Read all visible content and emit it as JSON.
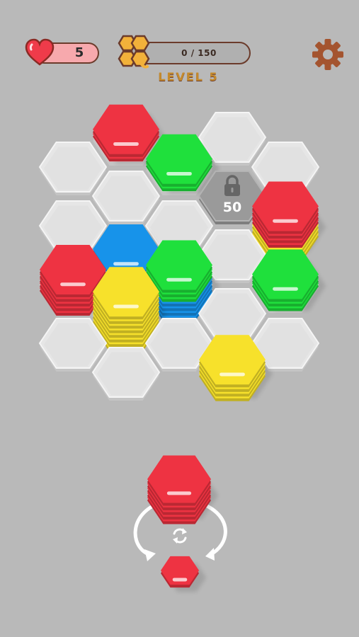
{
  "hud": {
    "lives": "5",
    "progress_text": "0 / 150",
    "progress_value": 0,
    "progress_max": 150,
    "level_label": "LEVEL 5",
    "heart_icon": "heart-icon",
    "honeycomb_icon": "honeycomb-icon",
    "settings_icon": "gear-icon"
  },
  "colors": {
    "red": "#ee3342",
    "green": "#1fe03c",
    "blue": "#1793ea",
    "yellow": "#f7e12b",
    "empty": "#e6e6e6",
    "locked": "#9a9a9a",
    "background": "#b9b9b9",
    "accent_brown": "#6b3b2b"
  },
  "board": {
    "cells": [
      {
        "col": 0,
        "row": 0,
        "state": "empty"
      },
      {
        "col": 0,
        "row": 1,
        "state": "empty"
      },
      {
        "col": 0,
        "row": 2,
        "state": "stack",
        "colors": [
          "red",
          "red",
          "red",
          "red",
          "red"
        ]
      },
      {
        "col": 0,
        "row": 3,
        "state": "empty"
      },
      {
        "col": 1,
        "row": 0,
        "state": "stack",
        "colors": [
          "red",
          "red"
        ]
      },
      {
        "col": 1,
        "row": 1,
        "state": "empty"
      },
      {
        "col": 1,
        "row": 2,
        "state": "stack",
        "colors": [
          "blue"
        ]
      },
      {
        "col": 1,
        "row": 3,
        "state": "stack",
        "colors": [
          "yellow",
          "yellow",
          "yellow",
          "yellow",
          "yellow",
          "yellow",
          "yellow",
          "yellow"
        ]
      },
      {
        "col": 1,
        "row": 4,
        "state": "empty"
      },
      {
        "col": 2,
        "row": 0,
        "state": "stack",
        "colors": [
          "green",
          "green"
        ]
      },
      {
        "col": 2,
        "row": 1,
        "state": "empty"
      },
      {
        "col": 2,
        "row": 2,
        "state": "stack",
        "colors": [
          "blue",
          "blue",
          "blue",
          "blue",
          "green",
          "green",
          "green"
        ]
      },
      {
        "col": 2,
        "row": 3,
        "state": "empty"
      },
      {
        "col": 3,
        "row": 0,
        "state": "empty"
      },
      {
        "col": 3,
        "row": 1,
        "state": "locked",
        "unlock_at": "50"
      },
      {
        "col": 3,
        "row": 2,
        "state": "empty"
      },
      {
        "col": 3,
        "row": 3,
        "state": "empty"
      },
      {
        "col": 3,
        "row": 4,
        "state": "stack",
        "colors": [
          "yellow",
          "yellow",
          "yellow",
          "yellow"
        ]
      },
      {
        "col": 4,
        "row": 0,
        "state": "empty"
      },
      {
        "col": 4,
        "row": 1,
        "state": "stack",
        "colors": [
          "yellow",
          "yellow",
          "yellow",
          "red",
          "red",
          "red",
          "red"
        ]
      },
      {
        "col": 4,
        "row": 2,
        "state": "stack",
        "colors": [
          "green",
          "green",
          "green"
        ]
      },
      {
        "col": 4,
        "row": 3,
        "state": "empty"
      }
    ]
  },
  "tray": {
    "main_piece": [
      "red",
      "red",
      "red",
      "red",
      "red"
    ],
    "next_piece": [
      "red"
    ],
    "swap_icon": "refresh-icon",
    "arrow_icon": "swap-arrows-icon"
  }
}
